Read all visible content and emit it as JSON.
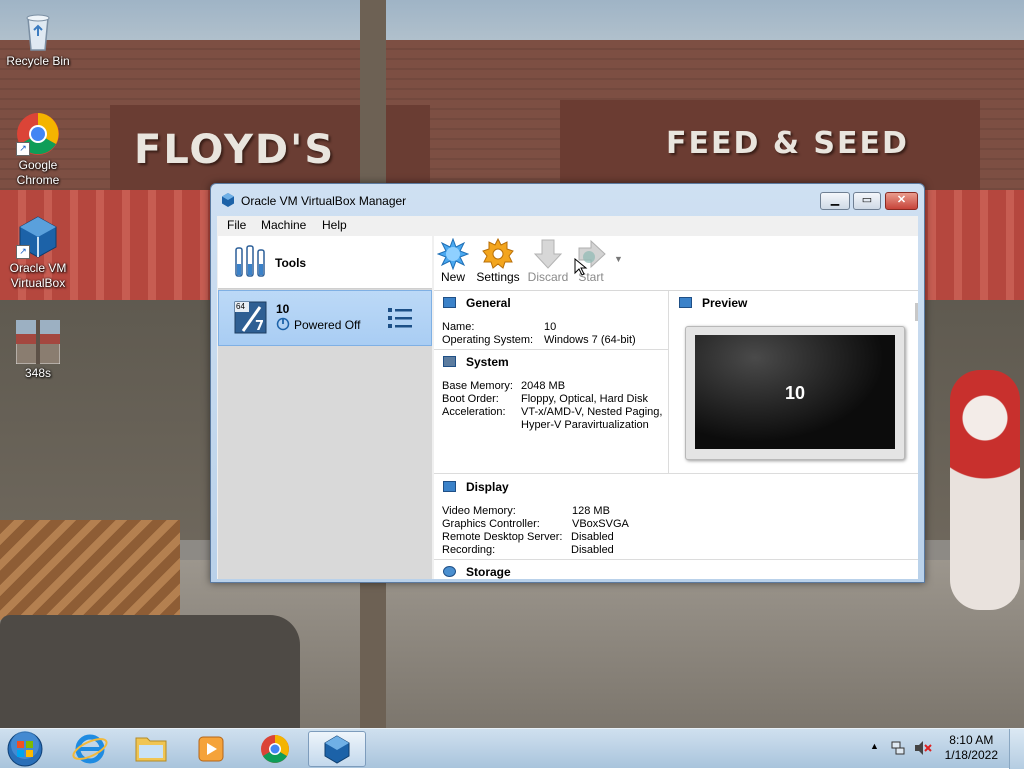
{
  "desktop": {
    "icons": [
      {
        "label": "Recycle Bin"
      },
      {
        "label": "Google Chrome"
      },
      {
        "label": "Oracle VM VirtualBox"
      },
      {
        "label": "348s"
      }
    ],
    "wallpaper_signs": [
      "FLOYD'S",
      "FEED & SEED"
    ]
  },
  "window": {
    "title": "Oracle VM VirtualBox Manager",
    "menu": [
      "File",
      "Machine",
      "Help"
    ],
    "sidebar": {
      "tools_label": "Tools",
      "vm": {
        "name": "10",
        "status": "Powered Off",
        "badge": "64"
      }
    },
    "toolbar": [
      {
        "label": "New",
        "enabled": true
      },
      {
        "label": "Settings",
        "enabled": true
      },
      {
        "label": "Discard",
        "enabled": false
      },
      {
        "label": "Start",
        "enabled": false
      }
    ],
    "general": {
      "title": "General",
      "rows": [
        {
          "key": "Name:",
          "value": "10"
        },
        {
          "key": "Operating System:",
          "value": "Windows 7 (64-bit)"
        }
      ]
    },
    "system": {
      "title": "System",
      "rows": [
        {
          "key": "Base Memory:",
          "value": "2048 MB"
        },
        {
          "key": "Boot Order:",
          "value": "Floppy, Optical, Hard Disk"
        },
        {
          "key": "Acceleration:",
          "value": "VT-x/AMD-V, Nested Paging,"
        },
        {
          "key": "",
          "value": "Hyper-V Paravirtualization"
        }
      ]
    },
    "preview": {
      "title": "Preview",
      "screen_text": "10"
    },
    "display": {
      "title": "Display",
      "rows": [
        {
          "key": "Video Memory:",
          "value": "128 MB"
        },
        {
          "key": "Graphics Controller:",
          "value": "VBoxSVGA"
        },
        {
          "key": "Remote Desktop Server:",
          "value": "Disabled"
        },
        {
          "key": "Recording:",
          "value": "Disabled"
        }
      ]
    },
    "storage": {
      "title": "Storage"
    }
  },
  "taskbar": {
    "time": "8:10 AM",
    "date": "1/18/2022",
    "colors": {
      "accent": "#3b82c9",
      "selection": "#a9cdf3"
    }
  }
}
